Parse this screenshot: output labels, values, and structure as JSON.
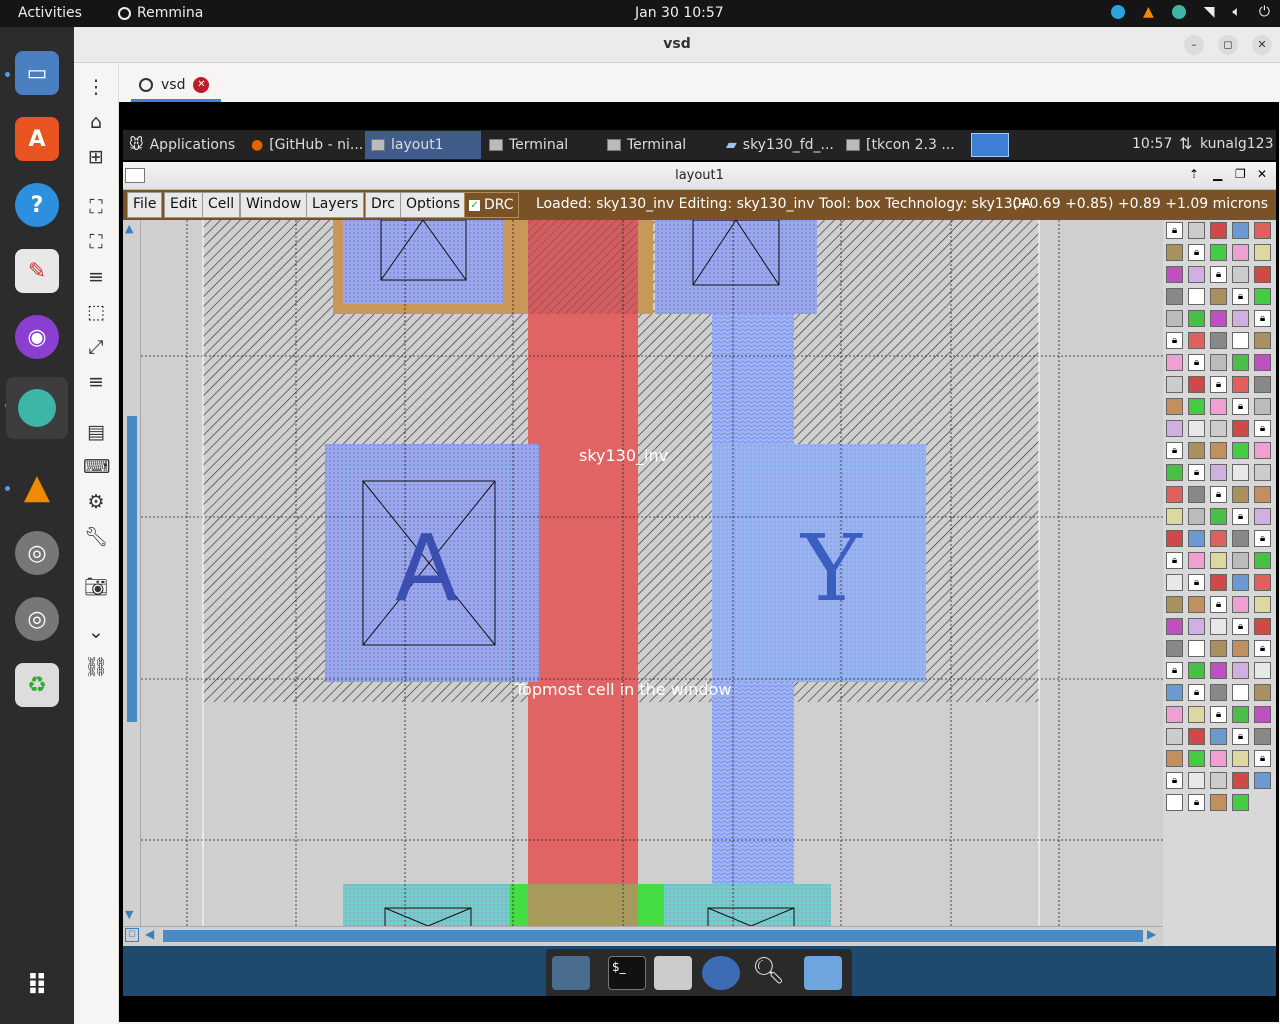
{
  "gnome": {
    "activities": "Activities",
    "app_name": "Remmina",
    "datetime": "Jan 30  10:57"
  },
  "dock": {
    "items": [
      "Files",
      "Ubuntu Software",
      "Help",
      "Text Editor",
      "Firefox",
      "Remmina",
      "VLC",
      "Disc",
      "Disc",
      "Trash",
      "Show Applications"
    ]
  },
  "remmina": {
    "window_title": "vsd",
    "tab_label": "vsd"
  },
  "remote": {
    "panel": {
      "applications": "Applications",
      "tasks": [
        "[GitHub - ni...",
        "layout1",
        "Terminal",
        "Terminal",
        "sky130_fd_...",
        "[tkcon 2.3 ..."
      ],
      "time": "10:57",
      "user": "kunalg123"
    },
    "magic": {
      "title": "layout1",
      "menu": [
        "File",
        "Edit",
        "Cell",
        "Window",
        "Layers",
        "Drc",
        "Options"
      ],
      "drc_label": "DRC",
      "status": "Loaded: sky130_inv Editing: sky130_inv Tool: box  Technology: sky130A",
      "coords": "(+0.69 +0.85) +0.89 +1.09 microns",
      "cell_label": "sky130_inv",
      "port_a": "A",
      "port_y": "Y",
      "topmost_label": "Topmost cell in the window"
    }
  },
  "colors": {
    "poly": "#e05a5a",
    "locali": "#8f8fe8",
    "metal": "#9fb6f0",
    "diff": "#3cc8c8",
    "menubar": "#7a5227"
  }
}
